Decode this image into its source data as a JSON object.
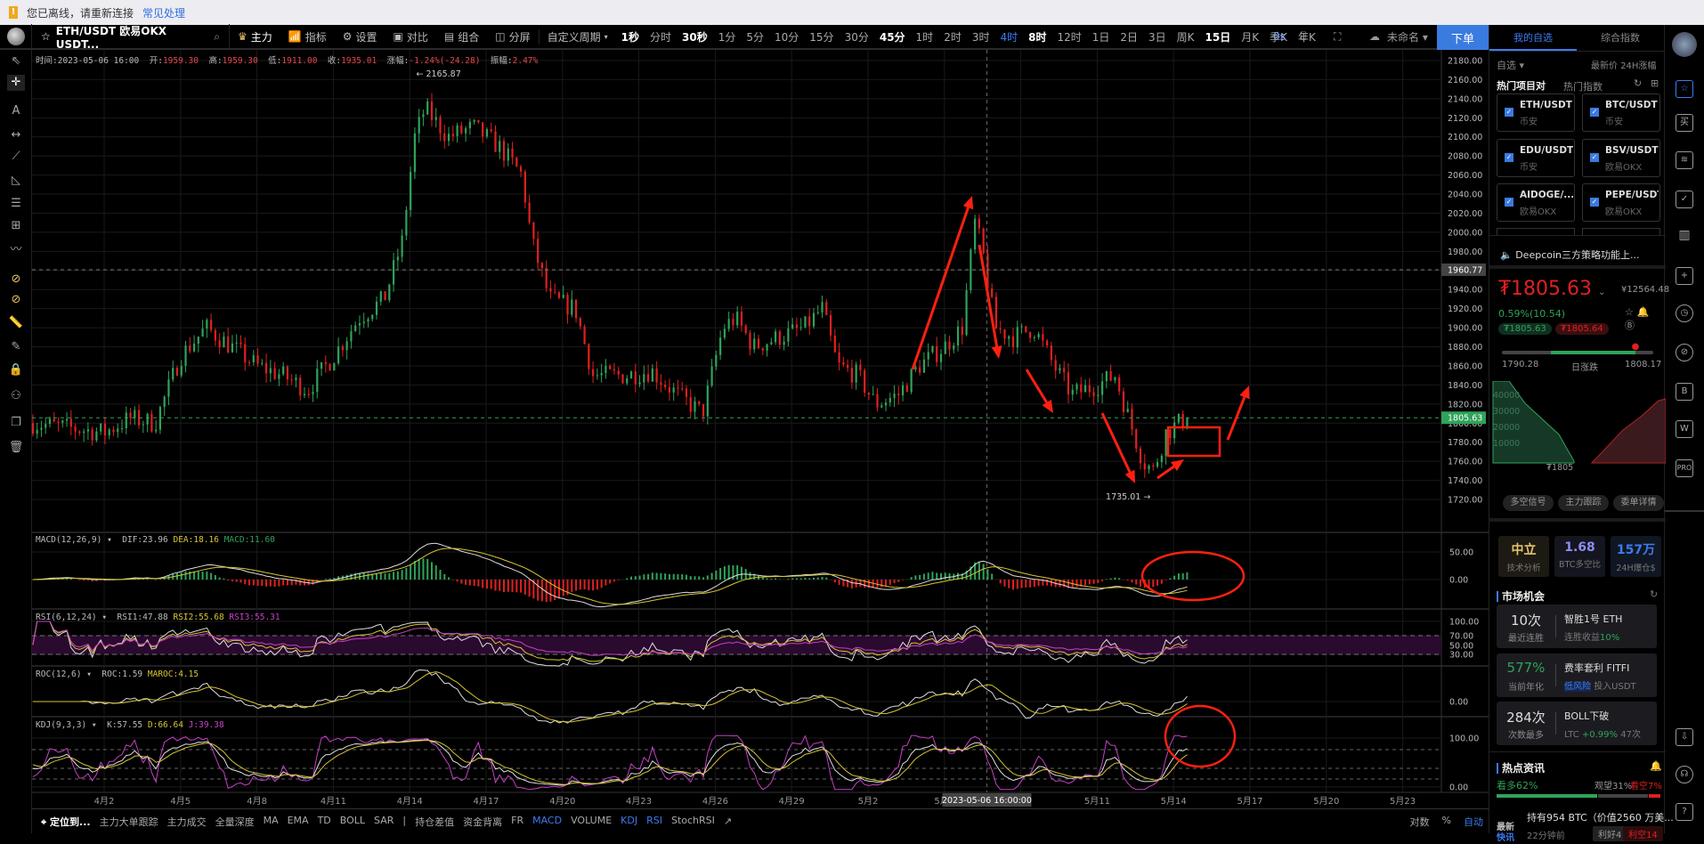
{
  "notice": {
    "message": "您已离线，请重新连接",
    "link": "常见处理"
  },
  "toolbar": {
    "symbol": "ETH/USDT 欧易OKX USDT...",
    "buttons": [
      "主力",
      "指标",
      "设置",
      "对比",
      "组合",
      "分屏"
    ],
    "custom_period": "自定义周期",
    "timeframes": [
      "1秒",
      "分时",
      "30秒",
      "1分",
      "5分",
      "10分",
      "15分",
      "30分",
      "45分",
      "1时",
      "2时",
      "3时",
      "4时",
      "8时",
      "12时",
      "1日",
      "2日",
      "3日",
      "周K",
      "15日",
      "月K",
      "季K",
      "年K"
    ],
    "bold_timeframes": [
      "1秒",
      "30秒",
      "45分",
      "8时",
      "15日"
    ],
    "selected_timeframe": "4时",
    "countdown": "0s",
    "layout_name": "未命名",
    "order_button": "下单"
  },
  "info": {
    "time_label": "时间:",
    "time": "2023-05-06 16:00",
    "open_label": "开:",
    "open": "1959.30",
    "high_label": "高:",
    "high": "1959.30",
    "low_label": "低:",
    "low": "1911.00",
    "close_label": "收:",
    "close": "1935.01",
    "change_label": "涨幅:",
    "change": "-1.24%(-24.28)",
    "amp_label": "振幅:",
    "amp": "2.47%"
  },
  "indicators": {
    "macd": {
      "name": "MACD(12,26,9)",
      "dif": "DIF:23.96",
      "dea": "DEA:18.16",
      "macd": "MACD:11.60",
      "ticks": [
        "50.00",
        "0.00"
      ]
    },
    "rsi": {
      "name": "RSI(6,12,24)",
      "rsi1": "RSI1:47.88",
      "rsi2": "RSI2:55.68",
      "rsi3": "RSI3:55.31",
      "ticks": [
        "100.00",
        "70.00",
        "50.00",
        "30.00"
      ]
    },
    "roc": {
      "name": "ROC(12,6)",
      "roc": "ROC:1.59",
      "maroc": "MAROC:4.15",
      "ticks": [
        "0.00"
      ]
    },
    "kdj": {
      "name": "KDJ(9,3,3)",
      "k": "K:57.55",
      "d": "D:66.64",
      "j": "J:39.38",
      "ticks": [
        "100.00",
        "0.00"
      ]
    }
  },
  "chart_data": {
    "type": "candlestick",
    "symbol": "ETH/USDT",
    "interval": "4h",
    "y_ticks": [
      "2180.00",
      "2160.00",
      "2140.00",
      "2120.00",
      "2100.00",
      "2080.00",
      "2060.00",
      "2040.00",
      "2020.00",
      "2000.00",
      "1980.00",
      "1960.00",
      "1940.00",
      "1920.00",
      "1900.00",
      "1880.00",
      "1860.00",
      "1840.00",
      "1820.00",
      "1800.00",
      "1780.00",
      "1760.00",
      "1740.00",
      "1720.00"
    ],
    "ylim": [
      1720,
      2180
    ],
    "x_ticks": [
      "4月2",
      "4月5",
      "4月8",
      "4月11",
      "4月14",
      "4月17",
      "4月20",
      "4月23",
      "4月26",
      "4月29",
      "5月2",
      "5月5",
      "5月8",
      "5月11",
      "5月14",
      "5月17",
      "5月20",
      "5月23"
    ],
    "price_path_days_from_apr2": [
      [
        -2.8,
        1800
      ],
      [
        0,
        1790
      ],
      [
        1,
        1805
      ],
      [
        2,
        1800
      ],
      [
        3,
        1870
      ],
      [
        4,
        1900
      ],
      [
        5,
        1880
      ],
      [
        6,
        1860
      ],
      [
        7,
        1850
      ],
      [
        8,
        1835
      ],
      [
        9,
        1870
      ],
      [
        10,
        1910
      ],
      [
        11,
        1930
      ],
      [
        11.7,
        1990
      ],
      [
        12.2,
        2100
      ],
      [
        12.6,
        2130
      ],
      [
        13.5,
        2100
      ],
      [
        14.5,
        2110
      ],
      [
        15.5,
        2090
      ],
      [
        16.4,
        2060
      ],
      [
        16.8,
        1990
      ],
      [
        17.5,
        1930
      ],
      [
        18.5,
        1920
      ],
      [
        19.2,
        1850
      ],
      [
        20.5,
        1850
      ],
      [
        21.5,
        1855
      ],
      [
        22.5,
        1830
      ],
      [
        23.5,
        1810
      ],
      [
        24.3,
        1900
      ],
      [
        24.8,
        1910
      ],
      [
        25.5,
        1880
      ],
      [
        26.5,
        1890
      ],
      [
        27.5,
        1900
      ],
      [
        28.2,
        1920
      ],
      [
        28.8,
        1860
      ],
      [
        29.6,
        1850
      ],
      [
        30.3,
        1820
      ],
      [
        31.2,
        1830
      ],
      [
        32,
        1860
      ],
      [
        33,
        1880
      ],
      [
        33.7,
        1900
      ],
      [
        34.2,
        2010
      ],
      [
        34.5,
        1980
      ],
      [
        35,
        1900
      ],
      [
        35.7,
        1890
      ],
      [
        36.5,
        1900
      ],
      [
        37.3,
        1860
      ],
      [
        38,
        1830
      ],
      [
        39,
        1840
      ],
      [
        39.7,
        1850
      ],
      [
        40.3,
        1800
      ],
      [
        40.8,
        1760
      ],
      [
        41.2,
        1750
      ],
      [
        41.7,
        1790
      ],
      [
        42.2,
        1800
      ],
      [
        42.6,
        1805.63
      ]
    ],
    "last_price": "1805.63",
    "reference_line": "1960.77",
    "high_marker": "2165.87",
    "low_marker": "1735.01",
    "crosshair_time": "2023-05-06 16:00:00"
  },
  "bottombar": {
    "locate": "定位到...",
    "items": [
      "主力大单跟踪",
      "主力成交",
      "全量深度",
      "MA",
      "EMA",
      "TD",
      "BOLL",
      "SAR",
      "|",
      "持仓差值",
      "资金背离",
      "FR",
      "MACD",
      "VOLUME",
      "KDJ",
      "RSI",
      "StochRSI"
    ],
    "active": [
      "MACD",
      "KDJ",
      "RSI"
    ],
    "right": [
      "对数",
      "%",
      "自动"
    ]
  },
  "panel": {
    "tabs": [
      "我的自选",
      "综合指数"
    ],
    "filter": "自选",
    "col_price": "最新价",
    "col_change": "24H涨幅",
    "hot_title": "热门项目对",
    "hot_index": "热门指数",
    "pairs": [
      {
        "name": "ETH/USDT",
        "exchange": "币安"
      },
      {
        "name": "BTC/USDT",
        "exchange": "币安"
      },
      {
        "name": "EDU/USDT",
        "exchange": "币安"
      },
      {
        "name": "BSV/USDT",
        "exchange": "欧易OKX"
      },
      {
        "name": "AIDOGE/...",
        "exchange": "欧易OKX"
      },
      {
        "name": "PEPE/USDT",
        "exchange": "欧易OKX"
      }
    ],
    "announcement": "Deepcoin三方策略功能上...",
    "price": "1805.63",
    "price_cny": "¥12564.48",
    "change": "0.59%(10.54)",
    "bid": "₮1805.63",
    "ask": "₮1805.64",
    "range_low": "1790.28",
    "range_label": "日涨跌",
    "range_high": "1808.17",
    "range_position": 0.88,
    "depth_ticks": [
      "40000",
      "30000",
      "20000",
      "10000"
    ],
    "depth_mid": "₮1805",
    "buttons": [
      "多空信号",
      "主力跟踪",
      "委单详情"
    ],
    "stats": [
      {
        "value": "中立",
        "label": "技术分析"
      },
      {
        "value": "1.68",
        "label": "BTC多空比"
      },
      {
        "value": "157万",
        "label": "24H爆仓$"
      }
    ],
    "market_title": "市场机会",
    "opportunities": [
      {
        "value": "10次",
        "label": "最近连胜",
        "title": "智胜1号 ETH",
        "sub": "连胜收益",
        "sub_hl": "10%"
      },
      {
        "value": "577%",
        "label": "当前年化",
        "title": "费率套利 FITFI",
        "sub": "投入USDT",
        "sub_hl": "低风险"
      },
      {
        "value": "284次",
        "label": "次数最多",
        "title": "BOLL下破",
        "sub": "LTC",
        "sub_hl": "+0.99%",
        "sub2": "47次"
      }
    ],
    "news_title": "热点资讯",
    "bull": "看多62%",
    "neutral": "观望31%",
    "bear": "看空7%",
    "bull_pct": 62,
    "neutral_pct": 31,
    "bear_pct": 7,
    "news_tag1": "最新",
    "news_tag2": "快讯",
    "news_headline": "持有954 BTC（价值2560 万美...",
    "news_time": "22分钟前",
    "good": "利好4",
    "bad": "利空14"
  },
  "colors": {
    "up": "#2fa35a",
    "down": "#e02020",
    "accent": "#3a7be0",
    "annotation": "#ff2010"
  }
}
